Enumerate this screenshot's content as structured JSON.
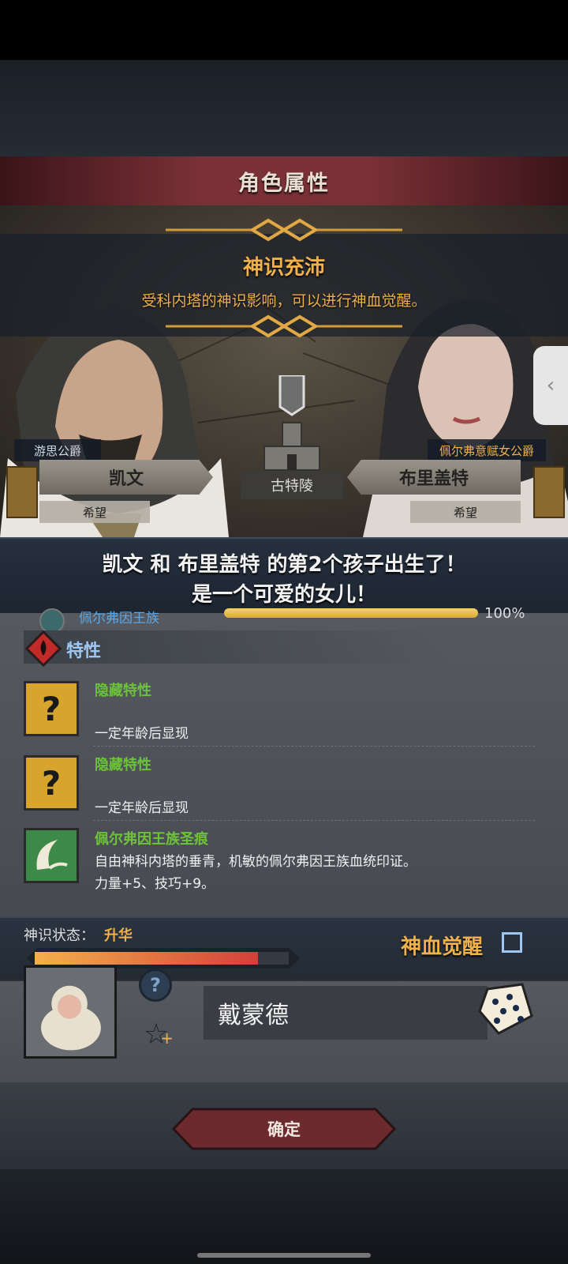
{
  "header": {
    "title": "角色属性"
  },
  "event": {
    "title": "神识充沛",
    "description": "受科内塔的神识影响，可以进行神血觉醒。"
  },
  "parents": {
    "father": {
      "title": "游思公爵",
      "name": "凯文",
      "mood": "希望"
    },
    "mother": {
      "title": "佩尔弗意赋女公爵",
      "name": "布里盖特",
      "mood": "希望"
    },
    "location": "古特陵"
  },
  "birth": {
    "line1": "凯文 和 布里盖特 的第2个孩子出生了！",
    "line2": "是一个可爱的女儿！"
  },
  "lineage": {
    "name": "佩尔弗因王族",
    "percent": "100%",
    "value": 1.0
  },
  "traits": {
    "section_title": "特性",
    "items": [
      {
        "name": "隐藏特性",
        "description": "一定年龄后显现",
        "icon": "question-icon"
      },
      {
        "name": "隐藏特性",
        "description": "一定年龄后显现",
        "icon": "question-icon"
      },
      {
        "name": "佩尔弗因王族圣痕",
        "description": "自由神科内塔的垂青，机敏的佩尔弗因王族血统印证。",
        "effect": "力量+5、技巧+9。",
        "icon": "horn-icon"
      }
    ]
  },
  "status": {
    "label": "神识状态：",
    "value": "升华",
    "progress": 0.88,
    "awaken_label": "神血觉醒"
  },
  "child": {
    "name": "戴蒙德"
  },
  "buttons": {
    "confirm": "确定"
  },
  "colors": {
    "accent_gold": "#f0b04a",
    "trait_green": "#6cc23a",
    "banner_red": "#7a3037"
  }
}
